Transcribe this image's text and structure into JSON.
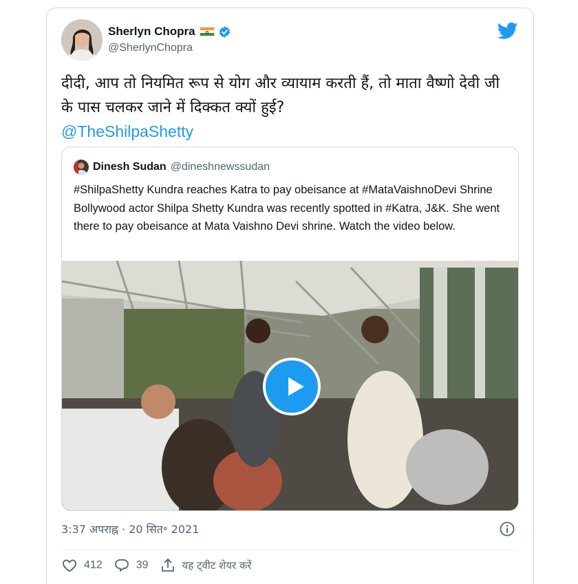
{
  "tweet": {
    "author": {
      "display_name": "Sherlyn Chopra",
      "handle": "@SherlynChopra",
      "flag": "india-flag-emoji",
      "verified": true
    },
    "text": "दीदी, आप तो नियमित रूप से योग और व्यायाम करती हैं, तो माता वैष्णो देवी जी के पास चलकर जाने में दिक्कत क्यों हुई?",
    "mention": "@TheShilpaShetty",
    "quoted_tweet": {
      "author_name": "Dinesh Sudan",
      "author_handle": "@dineshnewssudan",
      "text": "#ShilpaShetty Kundra reaches Katra to pay obeisance at #MataVaishnoDevi Shrine Bollywood actor Shilpa Shetty Kundra was recently spotted in #Katra, J&K. She went there to pay obeisance at Mata Vaishno Devi shrine. Watch the video below.",
      "media": {
        "type": "video",
        "icon": "play-icon"
      }
    },
    "timestamp": "3:37 अपराह्न · 20 सित॰ 2021",
    "actions": {
      "likes": "412",
      "replies": "39",
      "share_label": "यह ट्वीट शेयर करें"
    }
  },
  "colors": {
    "accent": "#1d9bf0",
    "text_primary": "#0f1419",
    "text_secondary": "#536471",
    "border": "#cfd9de"
  },
  "icons": [
    "twitter-bird-icon",
    "verified-badge-icon",
    "info-icon",
    "heart-icon",
    "reply-icon",
    "share-icon",
    "play-icon"
  ]
}
